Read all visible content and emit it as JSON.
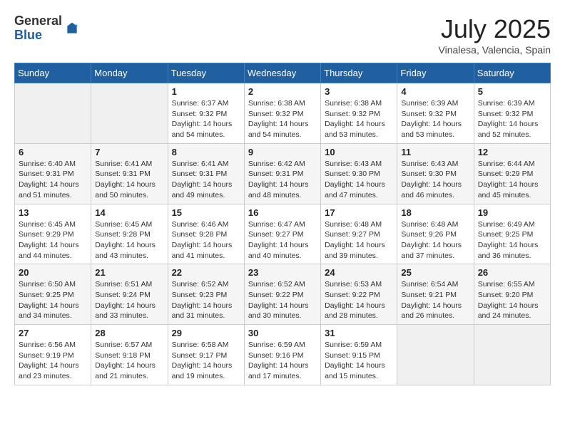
{
  "header": {
    "logo_general": "General",
    "logo_blue": "Blue",
    "month_title": "July 2025",
    "location": "Vinalesa, Valencia, Spain"
  },
  "weekdays": [
    "Sunday",
    "Monday",
    "Tuesday",
    "Wednesday",
    "Thursday",
    "Friday",
    "Saturday"
  ],
  "weeks": [
    [
      {
        "day": "",
        "info": ""
      },
      {
        "day": "",
        "info": ""
      },
      {
        "day": "1",
        "info": "Sunrise: 6:37 AM\nSunset: 9:32 PM\nDaylight: 14 hours and 54 minutes."
      },
      {
        "day": "2",
        "info": "Sunrise: 6:38 AM\nSunset: 9:32 PM\nDaylight: 14 hours and 54 minutes."
      },
      {
        "day": "3",
        "info": "Sunrise: 6:38 AM\nSunset: 9:32 PM\nDaylight: 14 hours and 53 minutes."
      },
      {
        "day": "4",
        "info": "Sunrise: 6:39 AM\nSunset: 9:32 PM\nDaylight: 14 hours and 53 minutes."
      },
      {
        "day": "5",
        "info": "Sunrise: 6:39 AM\nSunset: 9:32 PM\nDaylight: 14 hours and 52 minutes."
      }
    ],
    [
      {
        "day": "6",
        "info": "Sunrise: 6:40 AM\nSunset: 9:31 PM\nDaylight: 14 hours and 51 minutes."
      },
      {
        "day": "7",
        "info": "Sunrise: 6:41 AM\nSunset: 9:31 PM\nDaylight: 14 hours and 50 minutes."
      },
      {
        "day": "8",
        "info": "Sunrise: 6:41 AM\nSunset: 9:31 PM\nDaylight: 14 hours and 49 minutes."
      },
      {
        "day": "9",
        "info": "Sunrise: 6:42 AM\nSunset: 9:31 PM\nDaylight: 14 hours and 48 minutes."
      },
      {
        "day": "10",
        "info": "Sunrise: 6:43 AM\nSunset: 9:30 PM\nDaylight: 14 hours and 47 minutes."
      },
      {
        "day": "11",
        "info": "Sunrise: 6:43 AM\nSunset: 9:30 PM\nDaylight: 14 hours and 46 minutes."
      },
      {
        "day": "12",
        "info": "Sunrise: 6:44 AM\nSunset: 9:29 PM\nDaylight: 14 hours and 45 minutes."
      }
    ],
    [
      {
        "day": "13",
        "info": "Sunrise: 6:45 AM\nSunset: 9:29 PM\nDaylight: 14 hours and 44 minutes."
      },
      {
        "day": "14",
        "info": "Sunrise: 6:45 AM\nSunset: 9:28 PM\nDaylight: 14 hours and 43 minutes."
      },
      {
        "day": "15",
        "info": "Sunrise: 6:46 AM\nSunset: 9:28 PM\nDaylight: 14 hours and 41 minutes."
      },
      {
        "day": "16",
        "info": "Sunrise: 6:47 AM\nSunset: 9:27 PM\nDaylight: 14 hours and 40 minutes."
      },
      {
        "day": "17",
        "info": "Sunrise: 6:48 AM\nSunset: 9:27 PM\nDaylight: 14 hours and 39 minutes."
      },
      {
        "day": "18",
        "info": "Sunrise: 6:48 AM\nSunset: 9:26 PM\nDaylight: 14 hours and 37 minutes."
      },
      {
        "day": "19",
        "info": "Sunrise: 6:49 AM\nSunset: 9:25 PM\nDaylight: 14 hours and 36 minutes."
      }
    ],
    [
      {
        "day": "20",
        "info": "Sunrise: 6:50 AM\nSunset: 9:25 PM\nDaylight: 14 hours and 34 minutes."
      },
      {
        "day": "21",
        "info": "Sunrise: 6:51 AM\nSunset: 9:24 PM\nDaylight: 14 hours and 33 minutes."
      },
      {
        "day": "22",
        "info": "Sunrise: 6:52 AM\nSunset: 9:23 PM\nDaylight: 14 hours and 31 minutes."
      },
      {
        "day": "23",
        "info": "Sunrise: 6:52 AM\nSunset: 9:22 PM\nDaylight: 14 hours and 30 minutes."
      },
      {
        "day": "24",
        "info": "Sunrise: 6:53 AM\nSunset: 9:22 PM\nDaylight: 14 hours and 28 minutes."
      },
      {
        "day": "25",
        "info": "Sunrise: 6:54 AM\nSunset: 9:21 PM\nDaylight: 14 hours and 26 minutes."
      },
      {
        "day": "26",
        "info": "Sunrise: 6:55 AM\nSunset: 9:20 PM\nDaylight: 14 hours and 24 minutes."
      }
    ],
    [
      {
        "day": "27",
        "info": "Sunrise: 6:56 AM\nSunset: 9:19 PM\nDaylight: 14 hours and 23 minutes."
      },
      {
        "day": "28",
        "info": "Sunrise: 6:57 AM\nSunset: 9:18 PM\nDaylight: 14 hours and 21 minutes."
      },
      {
        "day": "29",
        "info": "Sunrise: 6:58 AM\nSunset: 9:17 PM\nDaylight: 14 hours and 19 minutes."
      },
      {
        "day": "30",
        "info": "Sunrise: 6:59 AM\nSunset: 9:16 PM\nDaylight: 14 hours and 17 minutes."
      },
      {
        "day": "31",
        "info": "Sunrise: 6:59 AM\nSunset: 9:15 PM\nDaylight: 14 hours and 15 minutes."
      },
      {
        "day": "",
        "info": ""
      },
      {
        "day": "",
        "info": ""
      }
    ]
  ]
}
